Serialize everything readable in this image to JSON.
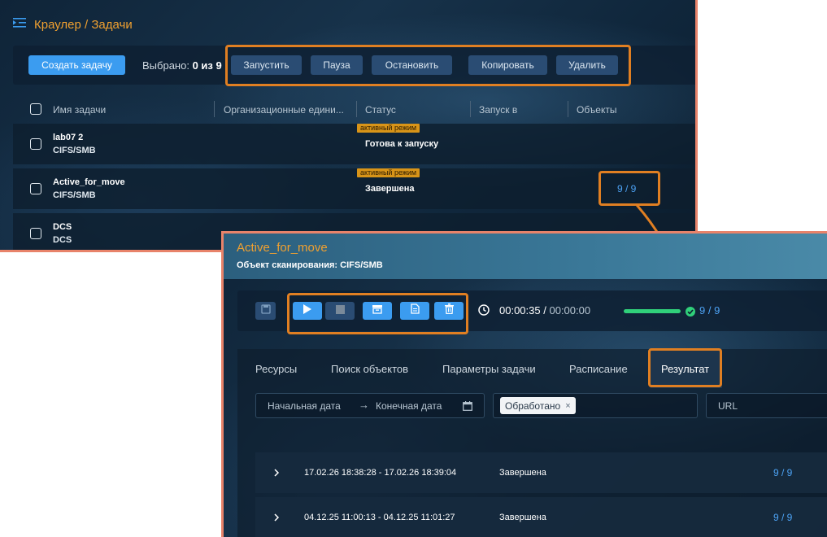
{
  "breadcrumb": {
    "text": "Краулер / Задачи",
    "icon": "menu-collapse-icon"
  },
  "toolbar": {
    "create_label": "Создать задачу",
    "selected_label": "Выбрано:",
    "selected_value": "0 из 9",
    "start_label": "Запустить",
    "pause_label": "Пауза",
    "stop_label": "Остановить",
    "copy_label": "Копировать",
    "delete_label": "Удалить"
  },
  "table": {
    "headers": [
      "Имя задачи",
      "Организационные едини...",
      "Статус",
      "Запуск в",
      "Объекты"
    ],
    "rows": [
      {
        "name": "lab07 2",
        "type": "CIFS/SMB",
        "tag": "активный режим",
        "status": "Готова к запуску",
        "objects": ""
      },
      {
        "name": "Active_for_move",
        "type": "CIFS/SMB",
        "tag": "активный режим",
        "status": "Завершена",
        "objects": "9 / 9"
      },
      {
        "name": "DCS",
        "type": "DCS",
        "tag": "",
        "status": "",
        "objects": ""
      }
    ]
  },
  "detail": {
    "title": "Active_for_move",
    "subtitle": "Объект сканирования: CIFS/SMB",
    "icons": [
      "save-icon",
      "play-icon",
      "stop-icon",
      "archive-icon",
      "document-icon",
      "trash-icon",
      "clock-icon",
      "check-circle-icon"
    ],
    "timer_elapsed": "00:00:35",
    "timer_separator": "/",
    "timer_total": "00:00:00",
    "progress_fraction": 1.0,
    "objects_count": "9 / 9",
    "tabs": [
      "Ресурсы",
      "Поиск объектов",
      "Параметры задачи",
      "Расписание",
      "Результат"
    ],
    "active_tab": "Результат",
    "filters": {
      "start_date_placeholder": "Начальная дата",
      "end_date_placeholder": "Конечная дата",
      "status_chip": "Обработано",
      "url_placeholder": "URL"
    },
    "results": [
      {
        "range": "17.02.26 18:38:28 - 17.02.26 18:39:04",
        "status": "Завершена",
        "count": "9 / 9"
      },
      {
        "range": "04.12.25 11:00:13 - 04.12.25 11:01:27",
        "status": "Завершена",
        "count": "9 / 9"
      }
    ]
  },
  "colors": {
    "accent_orange": "#f0a030",
    "highlight_orange": "#e07f22",
    "primary_blue": "#3b9cf0",
    "progress_green": "#30d07a",
    "tag_yellow": "#d89418"
  }
}
